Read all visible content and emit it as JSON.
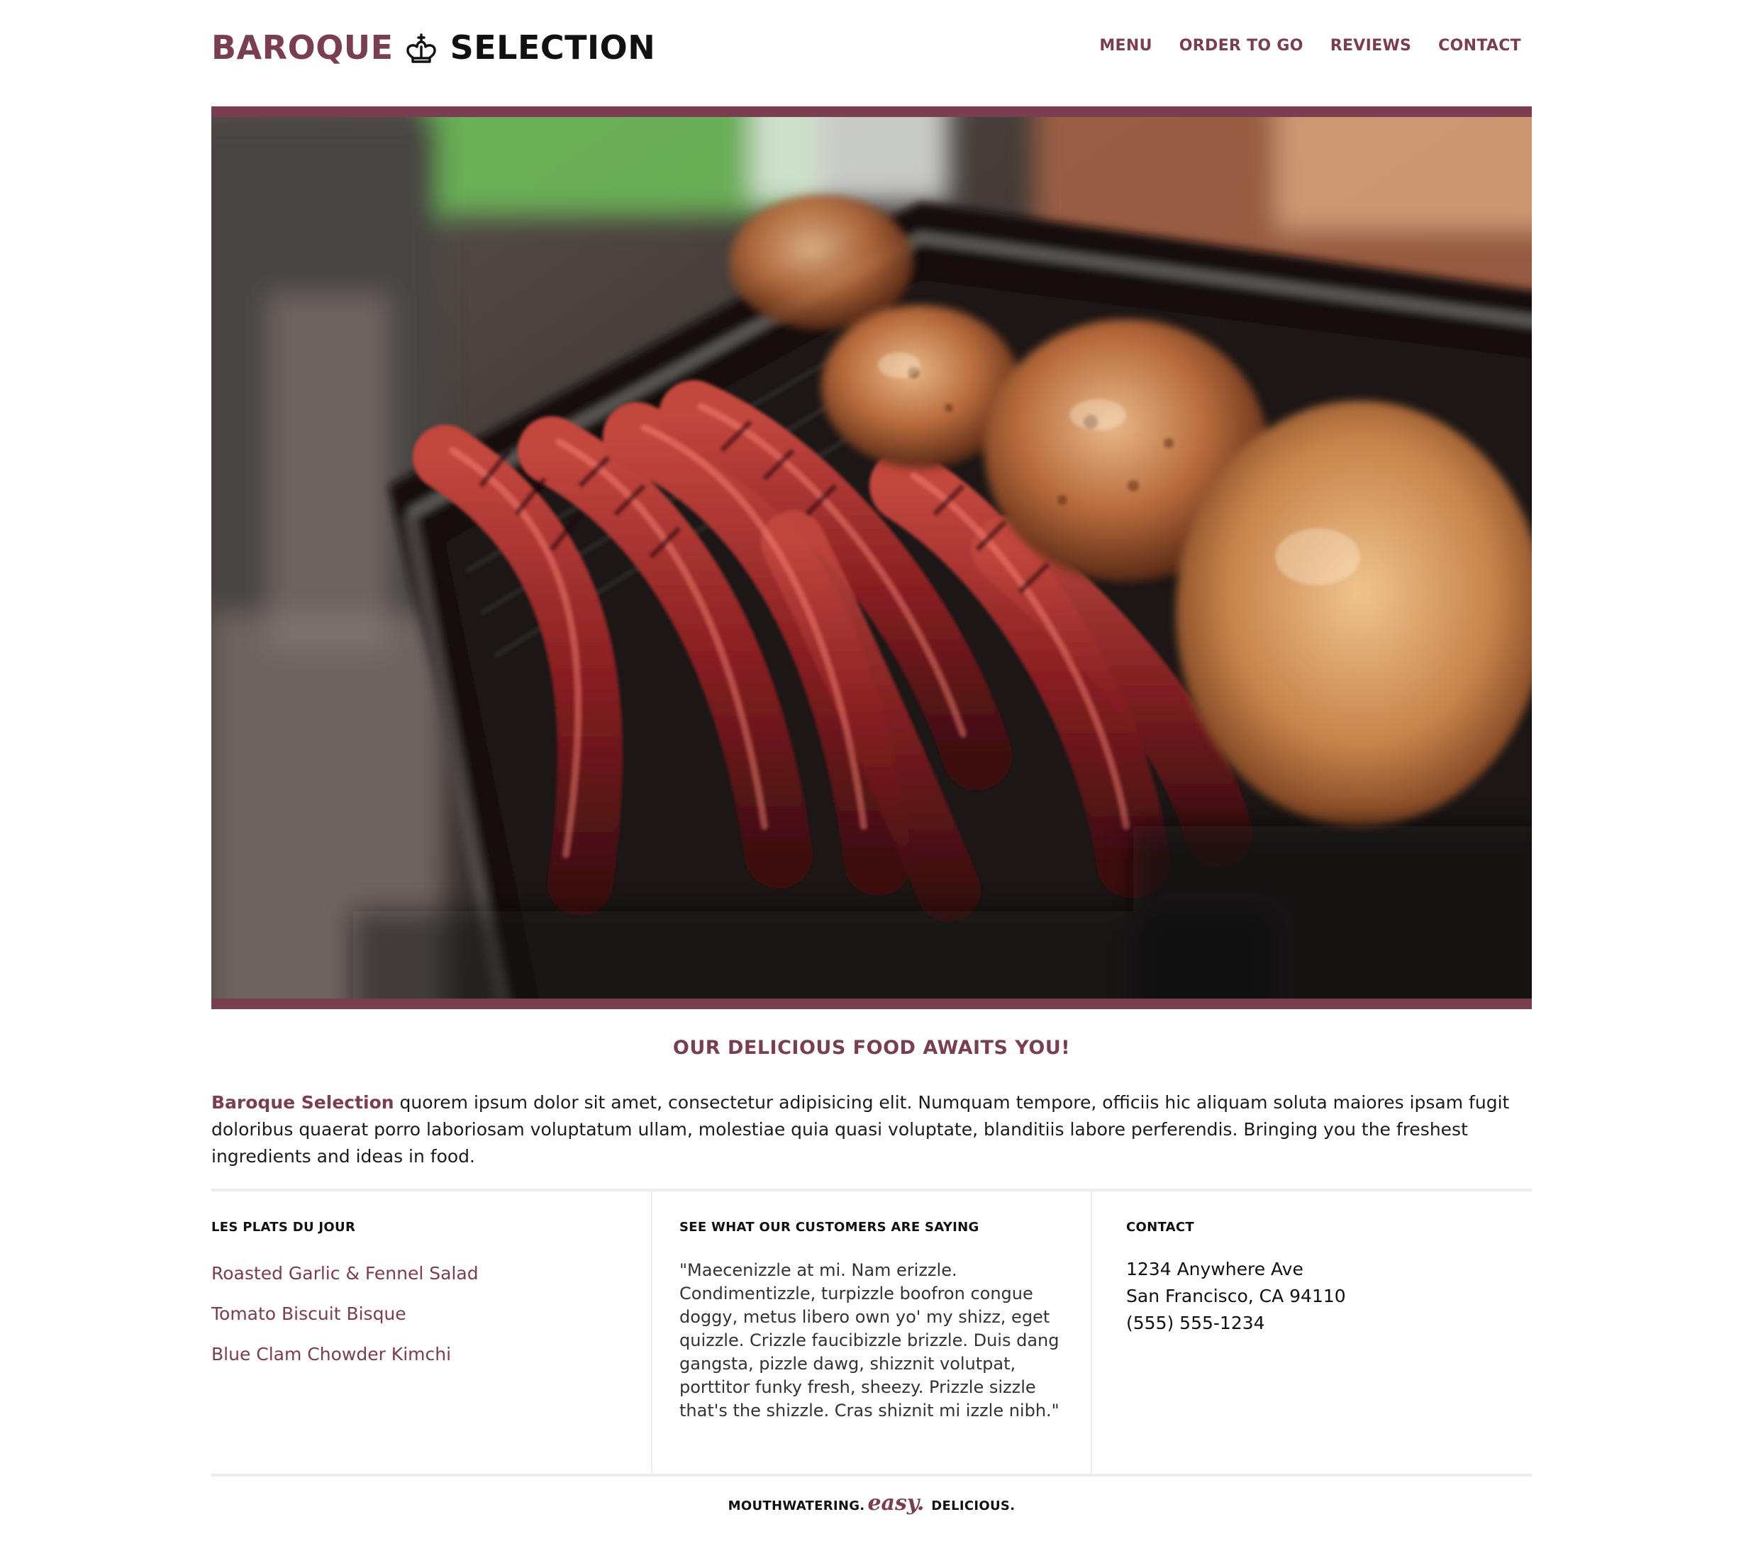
{
  "brand": {
    "name_part1": "BAROQUE",
    "name_part2": "SELECTION",
    "logo_icon": "crown-icon",
    "accent_color": "#7a3e51"
  },
  "nav": {
    "items": [
      {
        "label": "MENU"
      },
      {
        "label": "ORDER TO GO"
      },
      {
        "label": "REVIEWS"
      },
      {
        "label": "CONTACT"
      }
    ]
  },
  "hero": {
    "image_subject": "grilled sausages and chicken on a grill pan"
  },
  "main": {
    "tagline": "OUR DELICIOUS FOOD AWAITS YOU!",
    "intro_brand": "Baroque Selection",
    "intro_text": " quorem ipsum dolor sit amet, consectetur adipisicing elit. Numquam tempore, officiis hic aliquam soluta maiores ipsam fugit doloribus quaerat porro laboriosam voluptatum ullam, molestiae quia quasi voluptate, blanditiis labore perferendis. Bringing you the freshest ingredients and ideas in food."
  },
  "columns": {
    "specials": {
      "title": "LES PLATS DU JOUR",
      "items": [
        {
          "label": "Roasted Garlic & Fennel Salad"
        },
        {
          "label": "Tomato Biscuit Bisque"
        },
        {
          "label": "Blue Clam Chowder Kimchi"
        }
      ]
    },
    "reviews": {
      "title": "SEE WHAT OUR CUSTOMERS ARE SAYING",
      "quote": "\"Maecenizzle at mi. Nam erizzle. Condimentizzle, turpizzle boofron congue doggy, metus libero own yo' my shizz, eget quizzle. Crizzle faucibizzle brizzle. Duis dang gangsta, pizzle dawg, shizznit volutpat, porttitor funky fresh, sheezy. Prizzle sizzle that's the shizzle. Cras shiznit mi izzle nibh.\""
    },
    "contact": {
      "title": "CONTACT",
      "address_line1": "1234 Anywhere Ave",
      "address_line2": "San Francisco, CA 94110",
      "phone": "(555) 555-1234"
    }
  },
  "footer": {
    "part1": "MOUTHWATERING.",
    "part2": "easy.",
    "part3": "DELICIOUS."
  }
}
